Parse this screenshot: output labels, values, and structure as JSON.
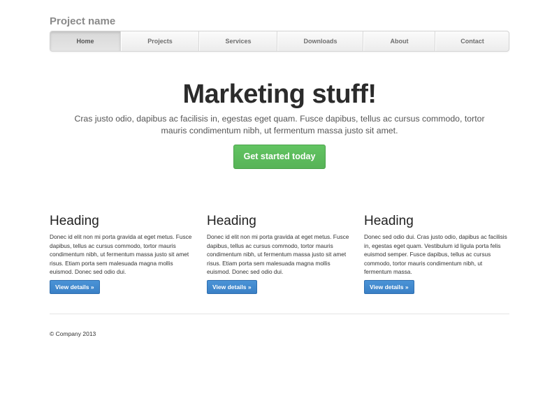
{
  "header": {
    "project_name": "Project name"
  },
  "nav": {
    "items": [
      {
        "label": "Home",
        "active": true
      },
      {
        "label": "Projects",
        "active": false
      },
      {
        "label": "Services",
        "active": false
      },
      {
        "label": "Downloads",
        "active": false
      },
      {
        "label": "About",
        "active": false
      },
      {
        "label": "Contact",
        "active": false
      }
    ]
  },
  "jumbotron": {
    "heading": "Marketing stuff!",
    "lead": "Cras justo odio, dapibus ac facilisis in, egestas eget quam. Fusce dapibus, tellus ac cursus commodo, tortor mauris condimentum nibh, ut fermentum massa justo sit amet.",
    "cta_label": "Get started today"
  },
  "columns": [
    {
      "heading": "Heading",
      "body": "Donec id elit non mi porta gravida at eget metus. Fusce dapibus, tellus ac cursus commodo, tortor mauris condimentum nibh, ut fermentum massa justo sit amet risus. Etiam porta sem malesuada magna mollis euismod. Donec sed odio dui.",
      "button_label": "View details »"
    },
    {
      "heading": "Heading",
      "body": "Donec id elit non mi porta gravida at eget metus. Fusce dapibus, tellus ac cursus commodo, tortor mauris condimentum nibh, ut fermentum massa justo sit amet risus. Etiam porta sem malesuada magna mollis euismod. Donec sed odio dui.",
      "button_label": "View details »"
    },
    {
      "heading": "Heading",
      "body": "Donec sed odio dui. Cras justo odio, dapibus ac facilisis in, egestas eget quam. Vestibulum id ligula porta felis euismod semper. Fusce dapibus, tellus ac cursus commodo, tortor mauris condimentum nibh, ut fermentum massa.",
      "button_label": "View details »"
    }
  ],
  "footer": {
    "text": "© Company 2013"
  },
  "colors": {
    "success_button": "#5cb85c",
    "primary_button": "#428bca",
    "muted_text": "#8a8a8a"
  }
}
